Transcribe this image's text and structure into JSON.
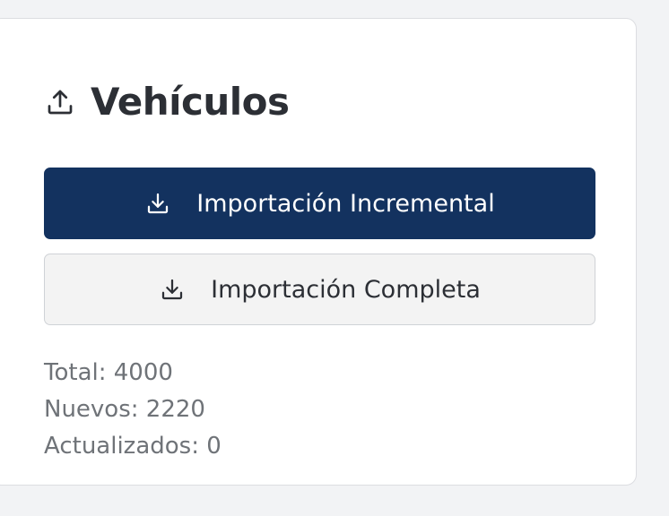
{
  "panel": {
    "title": "Vehículos",
    "title_icon": "upload-icon"
  },
  "buttons": {
    "incremental": {
      "label": "Importación Incremental",
      "icon": "download-icon",
      "bg_color": "#13325f"
    },
    "complete": {
      "label": "Importación Completa",
      "icon": "download-icon"
    }
  },
  "stats": {
    "total_label": "Total:",
    "total_value": "4000",
    "new_label": "Nuevos:",
    "new_value": "2220",
    "updated_label": "Actualizados:",
    "updated_value": "0"
  }
}
